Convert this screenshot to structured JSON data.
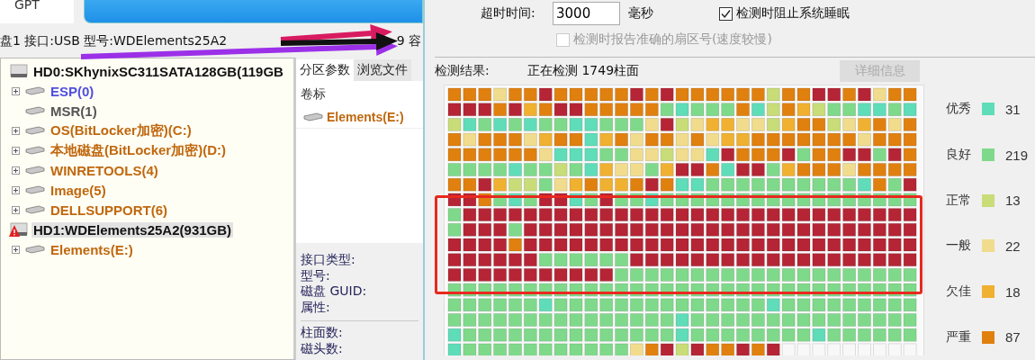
{
  "disk_tab": {
    "label": "GPT"
  },
  "info_line": [
    {
      "text": "盘1 接口:USB  型号:WDElements25A2"
    },
    {
      "text": "9  容"
    }
  ],
  "tree": [
    {
      "label": "HD0:SKhynixSC311SATA128GB(119GB",
      "warning": false,
      "selected": false,
      "children": [
        {
          "label": "ESP(0)",
          "color": "#4f4fe0",
          "expandable": true,
          "selected": false
        },
        {
          "label": "MSR(1)",
          "color": "#555555",
          "expandable": false,
          "selected": false
        },
        {
          "label": "OS(BitLocker加密)(C:)",
          "color": "#c0680f",
          "expandable": true,
          "selected": false
        },
        {
          "label": "本地磁盘(BitLocker加密)(D:)",
          "color": "#c0680f",
          "expandable": true,
          "selected": false
        },
        {
          "label": "WINRETOOLS(4)",
          "color": "#c0680f",
          "expandable": true,
          "selected": false
        },
        {
          "label": "Image(5)",
          "color": "#c0680f",
          "expandable": true,
          "selected": false
        },
        {
          "label": "DELLSUPPORT(6)",
          "color": "#c0680f",
          "expandable": true,
          "selected": false
        }
      ]
    },
    {
      "label": "HD1:WDElements25A2(931GB)",
      "warning": true,
      "selected": true,
      "children": [
        {
          "label": "Elements(E:)",
          "color": "#c0680f",
          "expandable": true,
          "selected": false
        }
      ]
    }
  ],
  "partition_panel": {
    "tabs": [
      {
        "label": "分区参数",
        "selected": true
      },
      {
        "label": "浏览文件",
        "selected": false
      }
    ],
    "column": "卷标",
    "rows": [
      {
        "label": "Elements(E:)"
      }
    ],
    "fields": [
      "接口类型:",
      "型号:",
      "磁盘 GUID:",
      "属性:"
    ],
    "fields_2": [
      "柱面数:",
      "磁头数:"
    ]
  },
  "options": {
    "timeout_label": "超时时间:",
    "timeout_value": "3000",
    "timeout_unit": "毫秒",
    "prevent_sleep": {
      "label": "检测时阻止系统睡眠",
      "checked": true,
      "disabled": false
    },
    "report_sector": {
      "label": "检测时报告准确的扇区号(速度较慢)",
      "checked": false,
      "disabled": true
    }
  },
  "result": {
    "label": "检测结果:",
    "status": "正在检测 1749柱面",
    "details_button": {
      "label": "详细信息",
      "disabled": true
    }
  },
  "scan_grid": {
    "rows": [
      [
        {
          "color": "#e0800f"
        },
        {
          "color": "#e0800f"
        },
        {
          "color": "#e0800f"
        },
        {
          "color": "#f0dc8c"
        },
        {
          "color": "#e0800f"
        },
        {
          "color": "#e0800f"
        },
        {
          "color": "#b52535"
        },
        {
          "color": "#e0800f"
        },
        {
          "color": "#e0800f"
        },
        {
          "color": "#e0800f"
        },
        {
          "color": "#e0800f"
        },
        {
          "color": "#e0800f"
        },
        {
          "color": "#b52535"
        },
        {
          "color": "#e0800f"
        },
        {
          "color": "#b52535"
        },
        {
          "color": "#e0800f"
        },
        {
          "color": "#e0800f"
        },
        {
          "color": "#e0800f"
        },
        {
          "color": "#e0800f"
        },
        {
          "color": "#e0800f"
        },
        {
          "color": "#e0800f"
        },
        {
          "color": "#c8dc78"
        },
        {
          "color": "#e0800f"
        },
        {
          "color": "#e0800f"
        },
        {
          "color": "#b52535"
        },
        {
          "color": "#b52535"
        },
        {
          "color": "#e0800f"
        },
        {
          "color": "#b52535"
        },
        {
          "color": "#f0dc8c"
        },
        {
          "color": "#e0800f"
        },
        {
          "color": "#e0800f"
        }
      ],
      [
        {
          "color": "#b52535"
        },
        {
          "color": "#b52535"
        },
        {
          "color": "#b52535"
        },
        {
          "color": "#e0800f"
        },
        {
          "color": "#b52535"
        },
        {
          "color": "#f0b030"
        },
        {
          "color": "#e0800f"
        },
        {
          "color": "#b52535"
        },
        {
          "color": "#b52535"
        },
        {
          "color": "#e0800f"
        },
        {
          "color": "#e0800f"
        },
        {
          "color": "#e0800f"
        },
        {
          "color": "#e0800f"
        },
        {
          "color": "#e0800f"
        },
        {
          "color": "#7fd98a"
        },
        {
          "color": "#5fdcb8"
        },
        {
          "color": "#7fd98a"
        },
        {
          "color": "#7fd98a"
        },
        {
          "color": "#7fd98a"
        },
        {
          "color": "#e0800f"
        },
        {
          "color": "#5fdcb8"
        },
        {
          "color": "#c8dc78"
        },
        {
          "color": "#e0800f"
        },
        {
          "color": "#f0b030"
        },
        {
          "color": "#c8dc78"
        },
        {
          "color": "#7fd98a"
        },
        {
          "color": "#7fd98a"
        },
        {
          "color": "#5fdcb8"
        },
        {
          "color": "#5fdcb8"
        },
        {
          "color": "#7fd98a"
        },
        {
          "color": "#5fdcb8"
        }
      ],
      [
        {
          "color": "#c8dc78"
        },
        {
          "color": "#5fdcb8"
        },
        {
          "color": "#7fd98a"
        },
        {
          "color": "#5fdcb8"
        },
        {
          "color": "#7fd98a"
        },
        {
          "color": "#5fdcb8"
        },
        {
          "color": "#7fd98a"
        },
        {
          "color": "#7fd98a"
        },
        {
          "color": "#5fdcb8"
        },
        {
          "color": "#5fdcb8"
        },
        {
          "color": "#7fd98a"
        },
        {
          "color": "#7fd98a"
        },
        {
          "color": "#7fd98a"
        },
        {
          "color": "#f0dc8c"
        },
        {
          "color": "#b52535"
        },
        {
          "color": "#c8dc78"
        },
        {
          "color": "#f0dc8c"
        },
        {
          "color": "#f0b030"
        },
        {
          "color": "#f0b030"
        },
        {
          "color": "#f0dc8c"
        },
        {
          "color": "#f0dc8c"
        },
        {
          "color": "#c8dc78"
        },
        {
          "color": "#f0b030"
        },
        {
          "color": "#e0800f"
        },
        {
          "color": "#e0800f"
        },
        {
          "color": "#c8dc78"
        },
        {
          "color": "#f0dc8c"
        },
        {
          "color": "#f0b030"
        },
        {
          "color": "#e0800f"
        },
        {
          "color": "#f0dc8c"
        },
        {
          "color": "#e0800f"
        }
      ],
      [
        {
          "color": "#e0800f"
        },
        {
          "color": "#f0dc8c"
        },
        {
          "color": "#e0800f"
        },
        {
          "color": "#e0800f"
        },
        {
          "color": "#e0800f"
        },
        {
          "color": "#f0dc8c"
        },
        {
          "color": "#f0b030"
        },
        {
          "color": "#e0800f"
        },
        {
          "color": "#e0800f"
        },
        {
          "color": "#5fdcb8"
        },
        {
          "color": "#f0b030"
        },
        {
          "color": "#e0800f"
        },
        {
          "color": "#f0dc8c"
        },
        {
          "color": "#e0800f"
        },
        {
          "color": "#e0800f"
        },
        {
          "color": "#f0dc8c"
        },
        {
          "color": "#e0800f"
        },
        {
          "color": "#f0dc8c"
        },
        {
          "color": "#f0b030"
        },
        {
          "color": "#f0b030"
        },
        {
          "color": "#e0800f"
        },
        {
          "color": "#e0800f"
        },
        {
          "color": "#e0800f"
        },
        {
          "color": "#e0800f"
        },
        {
          "color": "#e0800f"
        },
        {
          "color": "#e0800f"
        },
        {
          "color": "#e0800f"
        },
        {
          "color": "#f0dc8c"
        },
        {
          "color": "#e0800f"
        },
        {
          "color": "#e0800f"
        },
        {
          "color": "#e0800f"
        }
      ],
      [
        {
          "color": "#e0800f"
        },
        {
          "color": "#e0800f"
        },
        {
          "color": "#e0800f"
        },
        {
          "color": "#e0800f"
        },
        {
          "color": "#e0800f"
        },
        {
          "color": "#e0800f"
        },
        {
          "color": "#f0dc8c"
        },
        {
          "color": "#5fdcb8"
        },
        {
          "color": "#5fdcb8"
        },
        {
          "color": "#5fdcb8"
        },
        {
          "color": "#7fd98a"
        },
        {
          "color": "#7fd98a"
        },
        {
          "color": "#f0dc8c"
        },
        {
          "color": "#f0dc8c"
        },
        {
          "color": "#c8dc78"
        },
        {
          "color": "#f0dc8c"
        },
        {
          "color": "#f0dc8c"
        },
        {
          "color": "#5fdcb8"
        },
        {
          "color": "#b52535"
        },
        {
          "color": "#e0800f"
        },
        {
          "color": "#e0800f"
        },
        {
          "color": "#e0800f"
        },
        {
          "color": "#b52535"
        },
        {
          "color": "#7fd98a"
        },
        {
          "color": "#e0800f"
        },
        {
          "color": "#e0800f"
        },
        {
          "color": "#b52535"
        },
        {
          "color": "#b52535"
        },
        {
          "color": "#7fd98a"
        },
        {
          "color": "#b52535"
        },
        {
          "color": "#e0800f"
        }
      ],
      [
        {
          "color": "#7fd98a"
        },
        {
          "color": "#7fd98a"
        },
        {
          "color": "#7fd98a"
        },
        {
          "color": "#7fd98a"
        },
        {
          "color": "#5fdcb8"
        },
        {
          "color": "#7fd98a"
        },
        {
          "color": "#7fd98a"
        },
        {
          "color": "#c8dc78"
        },
        {
          "color": "#7fd98a"
        },
        {
          "color": "#5fdcb8"
        },
        {
          "color": "#f0b030"
        },
        {
          "color": "#f0dc8c"
        },
        {
          "color": "#f0dc8c"
        },
        {
          "color": "#7fd98a"
        },
        {
          "color": "#f0b030"
        },
        {
          "color": "#b52535"
        },
        {
          "color": "#b52535"
        },
        {
          "color": "#e0800f"
        },
        {
          "color": "#5fdcb8"
        },
        {
          "color": "#b52535"
        },
        {
          "color": "#b52535"
        },
        {
          "color": "#7fd98a"
        },
        {
          "color": "#f0b030"
        },
        {
          "color": "#e0800f"
        },
        {
          "color": "#e0800f"
        },
        {
          "color": "#e0800f"
        },
        {
          "color": "#f0dc8c"
        },
        {
          "color": "#e0800f"
        },
        {
          "color": "#e0800f"
        },
        {
          "color": "#e0800f"
        },
        {
          "color": "#e0800f"
        }
      ],
      [
        {
          "color": "#e0800f"
        },
        {
          "color": "#e0800f"
        },
        {
          "color": "#b52535"
        },
        {
          "color": "#f0b030"
        },
        {
          "color": "#c8dc78"
        },
        {
          "color": "#c8dc78"
        },
        {
          "color": "#7fd98a"
        },
        {
          "color": "#f0dc8c"
        },
        {
          "color": "#f0b030"
        },
        {
          "color": "#e0800f"
        },
        {
          "color": "#f0b030"
        },
        {
          "color": "#f0b030"
        },
        {
          "color": "#e0800f"
        },
        {
          "color": "#b52535"
        },
        {
          "color": "#e0800f"
        },
        {
          "color": "#5fdcb8"
        },
        {
          "color": "#5fdcb8"
        },
        {
          "color": "#7fd98a"
        },
        {
          "color": "#7fd98a"
        },
        {
          "color": "#7fd98a"
        },
        {
          "color": "#7fd98a"
        },
        {
          "color": "#7fd98a"
        },
        {
          "color": "#7fd98a"
        },
        {
          "color": "#7fd98a"
        },
        {
          "color": "#7fd98a"
        },
        {
          "color": "#7fd98a"
        },
        {
          "color": "#7fd98a"
        },
        {
          "color": "#5fdcb8"
        },
        {
          "color": "#e0800f"
        },
        {
          "color": "#7fd98a"
        },
        {
          "color": "#b52535"
        }
      ],
      [
        {
          "color": "#b52535"
        },
        {
          "color": "#b52535"
        },
        {
          "color": "#e0800f"
        },
        {
          "color": "#7fd98a"
        },
        {
          "color": "#5fdcb8"
        },
        {
          "color": "#7fd98a"
        },
        {
          "color": "#b52535"
        },
        {
          "color": "#b52535"
        },
        {
          "color": "#5fdcb8"
        },
        {
          "color": "#7fd98a"
        },
        {
          "color": "#b52535"
        },
        {
          "color": "#7fd98a"
        },
        {
          "color": "#7fd98a"
        },
        {
          "color": "#5fdcb8"
        },
        {
          "color": "#7fd98a"
        },
        {
          "color": "#7fd98a"
        },
        {
          "color": "#7fd98a"
        },
        {
          "color": "#7fd98a"
        },
        {
          "color": "#7fd98a"
        },
        {
          "color": "#7fd98a"
        },
        {
          "color": "#7fd98a"
        },
        {
          "color": "#7fd98a"
        },
        {
          "color": "#7fd98a"
        },
        {
          "color": "#7fd98a"
        },
        {
          "color": "#7fd98a"
        },
        {
          "color": "#7fd98a"
        },
        {
          "color": "#7fd98a"
        },
        {
          "color": "#7fd98a"
        },
        {
          "color": "#7fd98a"
        },
        {
          "color": "#7fd98a"
        },
        {
          "color": "#7fd98a"
        }
      ],
      [
        {
          "color": "#7fd98a"
        },
        {
          "color": "#b52535"
        },
        {
          "color": "#b52535"
        },
        {
          "color": "#b52535"
        },
        {
          "color": "#b52535"
        },
        {
          "color": "#b52535"
        },
        {
          "color": "#b52535"
        },
        {
          "color": "#b52535"
        },
        {
          "color": "#b52535"
        },
        {
          "color": "#b52535"
        },
        {
          "color": "#b52535"
        },
        {
          "color": "#b52535"
        },
        {
          "color": "#b52535"
        },
        {
          "color": "#b52535"
        },
        {
          "color": "#b52535"
        },
        {
          "color": "#b52535"
        },
        {
          "color": "#b52535"
        },
        {
          "color": "#b52535"
        },
        {
          "color": "#b52535"
        },
        {
          "color": "#b52535"
        },
        {
          "color": "#b52535"
        },
        {
          "color": "#b52535"
        },
        {
          "color": "#b52535"
        },
        {
          "color": "#b52535"
        },
        {
          "color": "#b52535"
        },
        {
          "color": "#b52535"
        },
        {
          "color": "#b52535"
        },
        {
          "color": "#b52535"
        },
        {
          "color": "#b52535"
        },
        {
          "color": "#b52535"
        },
        {
          "color": "#b52535"
        }
      ],
      [
        {
          "color": "#7fd98a"
        },
        {
          "color": "#b52535"
        },
        {
          "color": "#b52535"
        },
        {
          "color": "#b52535"
        },
        {
          "color": "#7fd98a"
        },
        {
          "color": "#b52535"
        },
        {
          "color": "#b52535"
        },
        {
          "color": "#b52535"
        },
        {
          "color": "#b52535"
        },
        {
          "color": "#b52535"
        },
        {
          "color": "#b52535"
        },
        {
          "color": "#b52535"
        },
        {
          "color": "#b52535"
        },
        {
          "color": "#b52535"
        },
        {
          "color": "#b52535"
        },
        {
          "color": "#b52535"
        },
        {
          "color": "#b52535"
        },
        {
          "color": "#b52535"
        },
        {
          "color": "#b52535"
        },
        {
          "color": "#b52535"
        },
        {
          "color": "#b52535"
        },
        {
          "color": "#b52535"
        },
        {
          "color": "#b52535"
        },
        {
          "color": "#b52535"
        },
        {
          "color": "#b52535"
        },
        {
          "color": "#b52535"
        },
        {
          "color": "#b52535"
        },
        {
          "color": "#b52535"
        },
        {
          "color": "#b52535"
        },
        {
          "color": "#b52535"
        },
        {
          "color": "#b52535"
        }
      ],
      [
        {
          "color": "#b52535"
        },
        {
          "color": "#b52535"
        },
        {
          "color": "#b52535"
        },
        {
          "color": "#b52535"
        },
        {
          "color": "#e0800f"
        },
        {
          "color": "#b52535"
        },
        {
          "color": "#b52535"
        },
        {
          "color": "#b52535"
        },
        {
          "color": "#b52535"
        },
        {
          "color": "#b52535"
        },
        {
          "color": "#b52535"
        },
        {
          "color": "#b52535"
        },
        {
          "color": "#b52535"
        },
        {
          "color": "#b52535"
        },
        {
          "color": "#b52535"
        },
        {
          "color": "#b52535"
        },
        {
          "color": "#b52535"
        },
        {
          "color": "#b52535"
        },
        {
          "color": "#b52535"
        },
        {
          "color": "#b52535"
        },
        {
          "color": "#b52535"
        },
        {
          "color": "#b52535"
        },
        {
          "color": "#b52535"
        },
        {
          "color": "#b52535"
        },
        {
          "color": "#b52535"
        },
        {
          "color": "#b52535"
        },
        {
          "color": "#b52535"
        },
        {
          "color": "#b52535"
        },
        {
          "color": "#b52535"
        },
        {
          "color": "#b52535"
        },
        {
          "color": "#b52535"
        }
      ],
      [
        {
          "color": "#b52535"
        },
        {
          "color": "#b52535"
        },
        {
          "color": "#b52535"
        },
        {
          "color": "#b52535"
        },
        {
          "color": "#b52535"
        },
        {
          "color": "#b52535"
        },
        {
          "color": "#7fd98a"
        },
        {
          "color": "#7fd98a"
        },
        {
          "color": "#7fd98a"
        },
        {
          "color": "#7fd98a"
        },
        {
          "color": "#7fd98a"
        },
        {
          "color": "#7fd98a"
        },
        {
          "color": "#b52535"
        },
        {
          "color": "#b52535"
        },
        {
          "color": "#b52535"
        },
        {
          "color": "#b52535"
        },
        {
          "color": "#b52535"
        },
        {
          "color": "#b52535"
        },
        {
          "color": "#b52535"
        },
        {
          "color": "#b52535"
        },
        {
          "color": "#b52535"
        },
        {
          "color": "#b52535"
        },
        {
          "color": "#b52535"
        },
        {
          "color": "#b52535"
        },
        {
          "color": "#b52535"
        },
        {
          "color": "#b52535"
        },
        {
          "color": "#b52535"
        },
        {
          "color": "#b52535"
        },
        {
          "color": "#b52535"
        },
        {
          "color": "#b52535"
        },
        {
          "color": "#b52535"
        }
      ],
      [
        {
          "color": "#b52535"
        },
        {
          "color": "#b52535"
        },
        {
          "color": "#b52535"
        },
        {
          "color": "#b52535"
        },
        {
          "color": "#b52535"
        },
        {
          "color": "#b52535"
        },
        {
          "color": "#b52535"
        },
        {
          "color": "#b52535"
        },
        {
          "color": "#b52535"
        },
        {
          "color": "#b52535"
        },
        {
          "color": "#b52535"
        },
        {
          "color": "#7fd98a"
        },
        {
          "color": "#7fd98a"
        },
        {
          "color": "#7fd98a"
        },
        {
          "color": "#7fd98a"
        },
        {
          "color": "#7fd98a"
        },
        {
          "color": "#7fd98a"
        },
        {
          "color": "#7fd98a"
        },
        {
          "color": "#7fd98a"
        },
        {
          "color": "#7fd98a"
        },
        {
          "color": "#7fd98a"
        },
        {
          "color": "#7fd98a"
        },
        {
          "color": "#7fd98a"
        },
        {
          "color": "#7fd98a"
        },
        {
          "color": "#7fd98a"
        },
        {
          "color": "#7fd98a"
        },
        {
          "color": "#7fd98a"
        },
        {
          "color": "#7fd98a"
        },
        {
          "color": "#7fd98a"
        },
        {
          "color": "#7fd98a"
        },
        {
          "color": "#7fd98a"
        }
      ],
      [
        {
          "color": "#7fd98a"
        },
        {
          "color": "#7fd98a"
        },
        {
          "color": "#7fd98a"
        },
        {
          "color": "#7fd98a"
        },
        {
          "color": "#7fd98a"
        },
        {
          "color": "#7fd98a"
        },
        {
          "color": "#7fd98a"
        },
        {
          "color": "#7fd98a"
        },
        {
          "color": "#7fd98a"
        },
        {
          "color": "#7fd98a"
        },
        {
          "color": "#7fd98a"
        },
        {
          "color": "#7fd98a"
        },
        {
          "color": "#7fd98a"
        },
        {
          "color": "#7fd98a"
        },
        {
          "color": "#7fd98a"
        },
        {
          "color": "#7fd98a"
        },
        {
          "color": "#7fd98a"
        },
        {
          "color": "#7fd98a"
        },
        {
          "color": "#7fd98a"
        },
        {
          "color": "#7fd98a"
        },
        {
          "color": "#7fd98a"
        },
        {
          "color": "#7fd98a"
        },
        {
          "color": "#7fd98a"
        },
        {
          "color": "#7fd98a"
        },
        {
          "color": "#7fd98a"
        },
        {
          "color": "#7fd98a"
        },
        {
          "color": "#7fd98a"
        },
        {
          "color": "#7fd98a"
        },
        {
          "color": "#7fd98a"
        },
        {
          "color": "#7fd98a"
        },
        {
          "color": "#7fd98a"
        }
      ],
      [
        {
          "color": "#7fd98a"
        },
        {
          "color": "#7fd98a"
        },
        {
          "color": "#7fd98a"
        },
        {
          "color": "#7fd98a"
        },
        {
          "color": "#7fd98a"
        },
        {
          "color": "#7fd98a"
        },
        {
          "color": "#5fdcb8"
        },
        {
          "color": "#7fd98a"
        },
        {
          "color": "#7fd98a"
        },
        {
          "color": "#7fd98a"
        },
        {
          "color": "#7fd98a"
        },
        {
          "color": "#7fd98a"
        },
        {
          "color": "#7fd98a"
        },
        {
          "color": "#7fd98a"
        },
        {
          "color": "#7fd98a"
        },
        {
          "color": "#7fd98a"
        },
        {
          "color": "#7fd98a"
        },
        {
          "color": "#7fd98a"
        },
        {
          "color": "#7fd98a"
        },
        {
          "color": "#7fd98a"
        },
        {
          "color": "#7fd98a"
        },
        {
          "color": "#5fdcb8"
        },
        {
          "color": "#7fd98a"
        },
        {
          "color": "#7fd98a"
        },
        {
          "color": "#7fd98a"
        },
        {
          "color": "#7fd98a"
        },
        {
          "color": "#7fd98a"
        },
        {
          "color": "#7fd98a"
        },
        {
          "color": "#7fd98a"
        },
        {
          "color": "#7fd98a"
        },
        {
          "color": "#7fd98a"
        }
      ],
      [
        {
          "color": "#7fd98a"
        },
        {
          "color": "#7fd98a"
        },
        {
          "color": "#7fd98a"
        },
        {
          "color": "#7fd98a"
        },
        {
          "color": "#7fd98a"
        },
        {
          "color": "#7fd98a"
        },
        {
          "color": "#7fd98a"
        },
        {
          "color": "#7fd98a"
        },
        {
          "color": "#7fd98a"
        },
        {
          "color": "#7fd98a"
        },
        {
          "color": "#7fd98a"
        },
        {
          "color": "#7fd98a"
        },
        {
          "color": "#7fd98a"
        },
        {
          "color": "#7fd98a"
        },
        {
          "color": "#7fd98a"
        },
        {
          "color": "#5fdcb8"
        },
        {
          "color": "#7fd98a"
        },
        {
          "color": "#7fd98a"
        },
        {
          "color": "#7fd98a"
        },
        {
          "color": "#7fd98a"
        },
        {
          "color": "#7fd98a"
        },
        {
          "color": "#7fd98a"
        },
        {
          "color": "#7fd98a"
        },
        {
          "color": "#7fd98a"
        },
        {
          "color": "#7fd98a"
        },
        {
          "color": "#7fd98a"
        },
        {
          "color": "#7fd98a"
        },
        {
          "color": "#7fd98a"
        },
        {
          "color": "#7fd98a"
        },
        {
          "color": "#7fd98a"
        },
        {
          "color": "#7fd98a"
        }
      ],
      [
        {
          "color": "#5fdcb8"
        },
        {
          "color": "#7fd98a"
        },
        {
          "color": "#7fd98a"
        },
        {
          "color": "#7fd98a"
        },
        {
          "color": "#7fd98a"
        },
        {
          "color": "#7fd98a"
        },
        {
          "color": "#7fd98a"
        },
        {
          "color": "#7fd98a"
        },
        {
          "color": "#7fd98a"
        },
        {
          "color": "#7fd98a"
        },
        {
          "color": "#7fd98a"
        },
        {
          "color": "#7fd98a"
        },
        {
          "color": "#7fd98a"
        },
        {
          "color": "#7fd98a"
        },
        {
          "color": "#7fd98a"
        },
        {
          "color": "#5fdcb8"
        },
        {
          "color": "#7fd98a"
        },
        {
          "color": "#7fd98a"
        },
        {
          "color": "#7fd98a"
        },
        {
          "color": "#7fd98a"
        },
        {
          "color": "#7fd98a"
        },
        {
          "color": "#7fd98a"
        },
        {
          "color": "#7fd98a"
        },
        {
          "color": "#7fd98a"
        },
        {
          "color": "#5fdcb8"
        },
        {
          "color": "#7fd98a"
        },
        {
          "color": "#7fd98a"
        },
        {
          "color": "#7fd98a"
        },
        {
          "color": "#7fd98a"
        },
        {
          "color": "#7fd98a"
        },
        {
          "color": "#7fd98a"
        }
      ],
      [
        {
          "color": "#5fdcb8"
        },
        {
          "color": "#7fd98a"
        },
        {
          "color": "#7fd98a"
        },
        {
          "color": "#7fd98a"
        },
        {
          "color": "#7fd98a"
        },
        {
          "color": "#7fd98a"
        },
        {
          "color": "#7fd98a"
        },
        {
          "color": "#7fd98a"
        },
        {
          "color": "#7fd98a"
        },
        {
          "color": "#7fd98a"
        },
        {
          "color": "#7fd98a"
        },
        {
          "color": "#7fd98a"
        },
        {
          "color": "#f0dc8c"
        },
        {
          "color": "#e0800f"
        },
        {
          "color": "#b52535"
        },
        {
          "color": "#c8dc78"
        },
        {
          "color": "#b52535"
        },
        {
          "color": "#e0800f"
        },
        {
          "color": "#e0800f"
        },
        {
          "color": "#b52535"
        },
        {
          "color": "#e0800f"
        },
        {
          "color": "#b52535"
        },
        {
          "color": "#f8f8f8"
        },
        {
          "color": "#f8f8f8"
        },
        {
          "color": "#f8f8f8"
        },
        {
          "color": "#f8f8f8"
        },
        {
          "color": "#f8f8f8"
        },
        {
          "color": "#f8f8f8"
        },
        {
          "color": "#f8f8f8"
        },
        {
          "color": "#f8f8f8"
        },
        {
          "color": "#f8f8f8"
        }
      ]
    ]
  },
  "legend": [
    {
      "label": "优秀",
      "color": "#5fdcb8",
      "count": "31"
    },
    {
      "label": "良好",
      "color": "#7fd98a",
      "count": "219"
    },
    {
      "label": "正常",
      "color": "#c8dc78",
      "count": "13"
    },
    {
      "label": "一般",
      "color": "#f0dc8c",
      "count": "22"
    },
    {
      "label": "欠佳",
      "color": "#f0b030",
      "count": "18"
    },
    {
      "label": "严重",
      "color": "#e0800f",
      "count": "87"
    }
  ],
  "annotations": [
    {
      "kind": "arrow",
      "color": "#9b30e8"
    },
    {
      "kind": "arrow",
      "color": "#d81b60"
    },
    {
      "kind": "arrow",
      "color": "#111111"
    },
    {
      "kind": "frame",
      "color": "#e8281e"
    }
  ]
}
